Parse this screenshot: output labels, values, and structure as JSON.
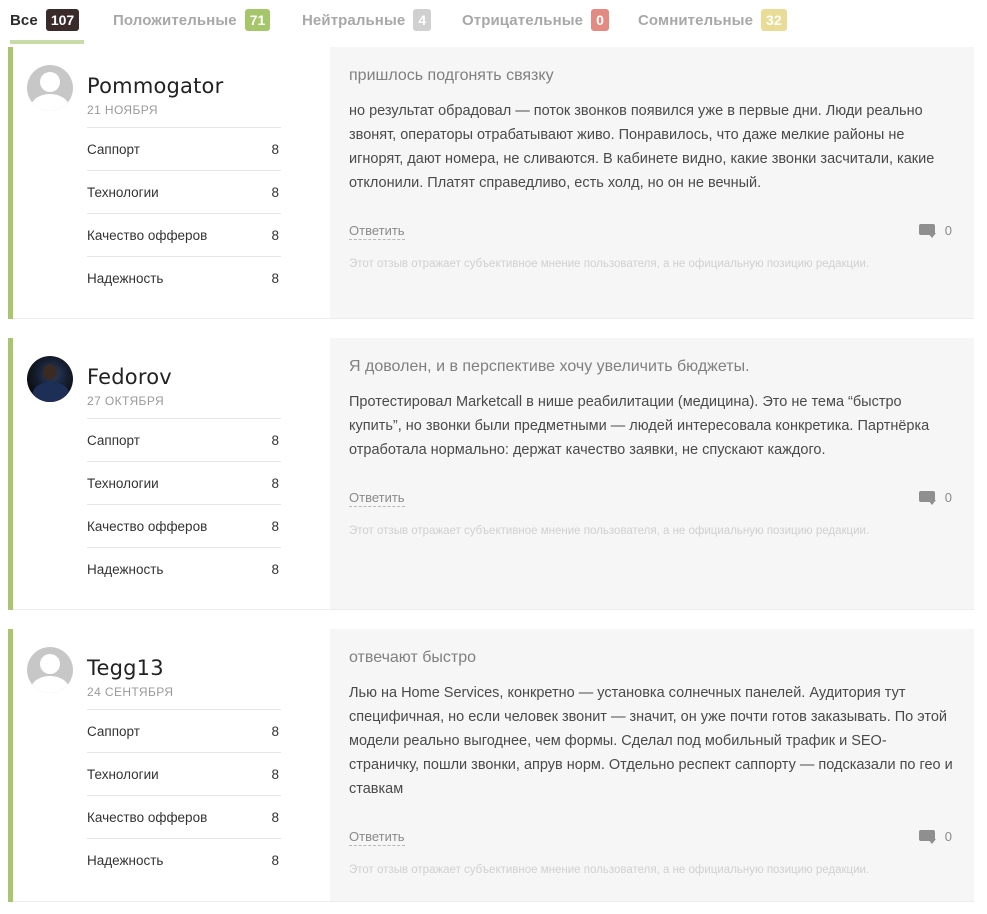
{
  "tabs": [
    {
      "label": "Все",
      "count": "107",
      "color": "#3a2a2a"
    },
    {
      "label": "Положительные",
      "count": "71",
      "color": "#a5c66a"
    },
    {
      "label": "Нейтральные",
      "count": "4",
      "color": "#d0d0d0"
    },
    {
      "label": "Отрицательные",
      "count": "0",
      "color": "#e38b83"
    },
    {
      "label": "Сомнительные",
      "count": "32",
      "color": "#e8dc96"
    }
  ],
  "accent_color": "#a9c66f",
  "reviews": [
    {
      "author": "Pommogator",
      "date": "21 НОЯБРЯ",
      "avatar": "default-user-icon",
      "ratings": [
        {
          "label": "Саппорт",
          "value": "8"
        },
        {
          "label": "Технологии",
          "value": "8"
        },
        {
          "label": "Качество офферов",
          "value": "8"
        },
        {
          "label": "Надежность",
          "value": "8"
        }
      ],
      "title": "пришлось подгонять связку",
      "text": "но результат обрадовал — поток звонков появился уже в первые дни. Люди реально звонят, операторы отрабатывают живо. Понравилось, что даже мелкие районы не игнорят, дают номера, не сливаются. В кабинете видно, какие звонки засчитали, какие отклонили. Платят справедливо, есть холд, но он не вечный.",
      "reply_label": "Ответить",
      "comment_count": "0",
      "disclaimer": "Этот отзыв отражает субъективное мнение пользователя, а не официальную позицию редакции."
    },
    {
      "author": "Fedorov",
      "date": "27 ОКТЯБРЯ",
      "avatar": "user-photo",
      "ratings": [
        {
          "label": "Саппорт",
          "value": "8"
        },
        {
          "label": "Технологии",
          "value": "8"
        },
        {
          "label": "Качество офферов",
          "value": "8"
        },
        {
          "label": "Надежность",
          "value": "8"
        }
      ],
      "title": "Я доволен, и в перспективе хочу увеличить бюджеты.",
      "text": "Протестировал Marketcall в нише реабилитации (медицина). Это не тема “быстро купить”, но звонки были предметными — людей интересовала конкретика. Партнёрка отработала нормально: держат качество заявки, не спускают каждого.",
      "reply_label": "Ответить",
      "comment_count": "0",
      "disclaimer": "Этот отзыв отражает субъективное мнение пользователя, а не официальную позицию редакции."
    },
    {
      "author": "Tegg13",
      "date": "24 СЕНТЯБРЯ",
      "avatar": "default-user-icon",
      "ratings": [
        {
          "label": "Саппорт",
          "value": "8"
        },
        {
          "label": "Технологии",
          "value": "8"
        },
        {
          "label": "Качество офферов",
          "value": "8"
        },
        {
          "label": "Надежность",
          "value": "8"
        }
      ],
      "title": "отвечают быстро",
      "text": "Лью на Home Services, конкретно — установка солнечных панелей. Аудитория тут специфичная, но если человек звонит — значит, он уже почти готов заказывать. По этой модели реально выгоднее, чем формы. Сделал под мобильный трафик и SEO-страничку, пошли звонки, апрув норм. Отдельно респект саппорту — подсказали по гео и ставкам",
      "reply_label": "Ответить",
      "comment_count": "0",
      "disclaimer": "Этот отзыв отражает субъективное мнение пользователя, а не официальную позицию редакции."
    }
  ]
}
